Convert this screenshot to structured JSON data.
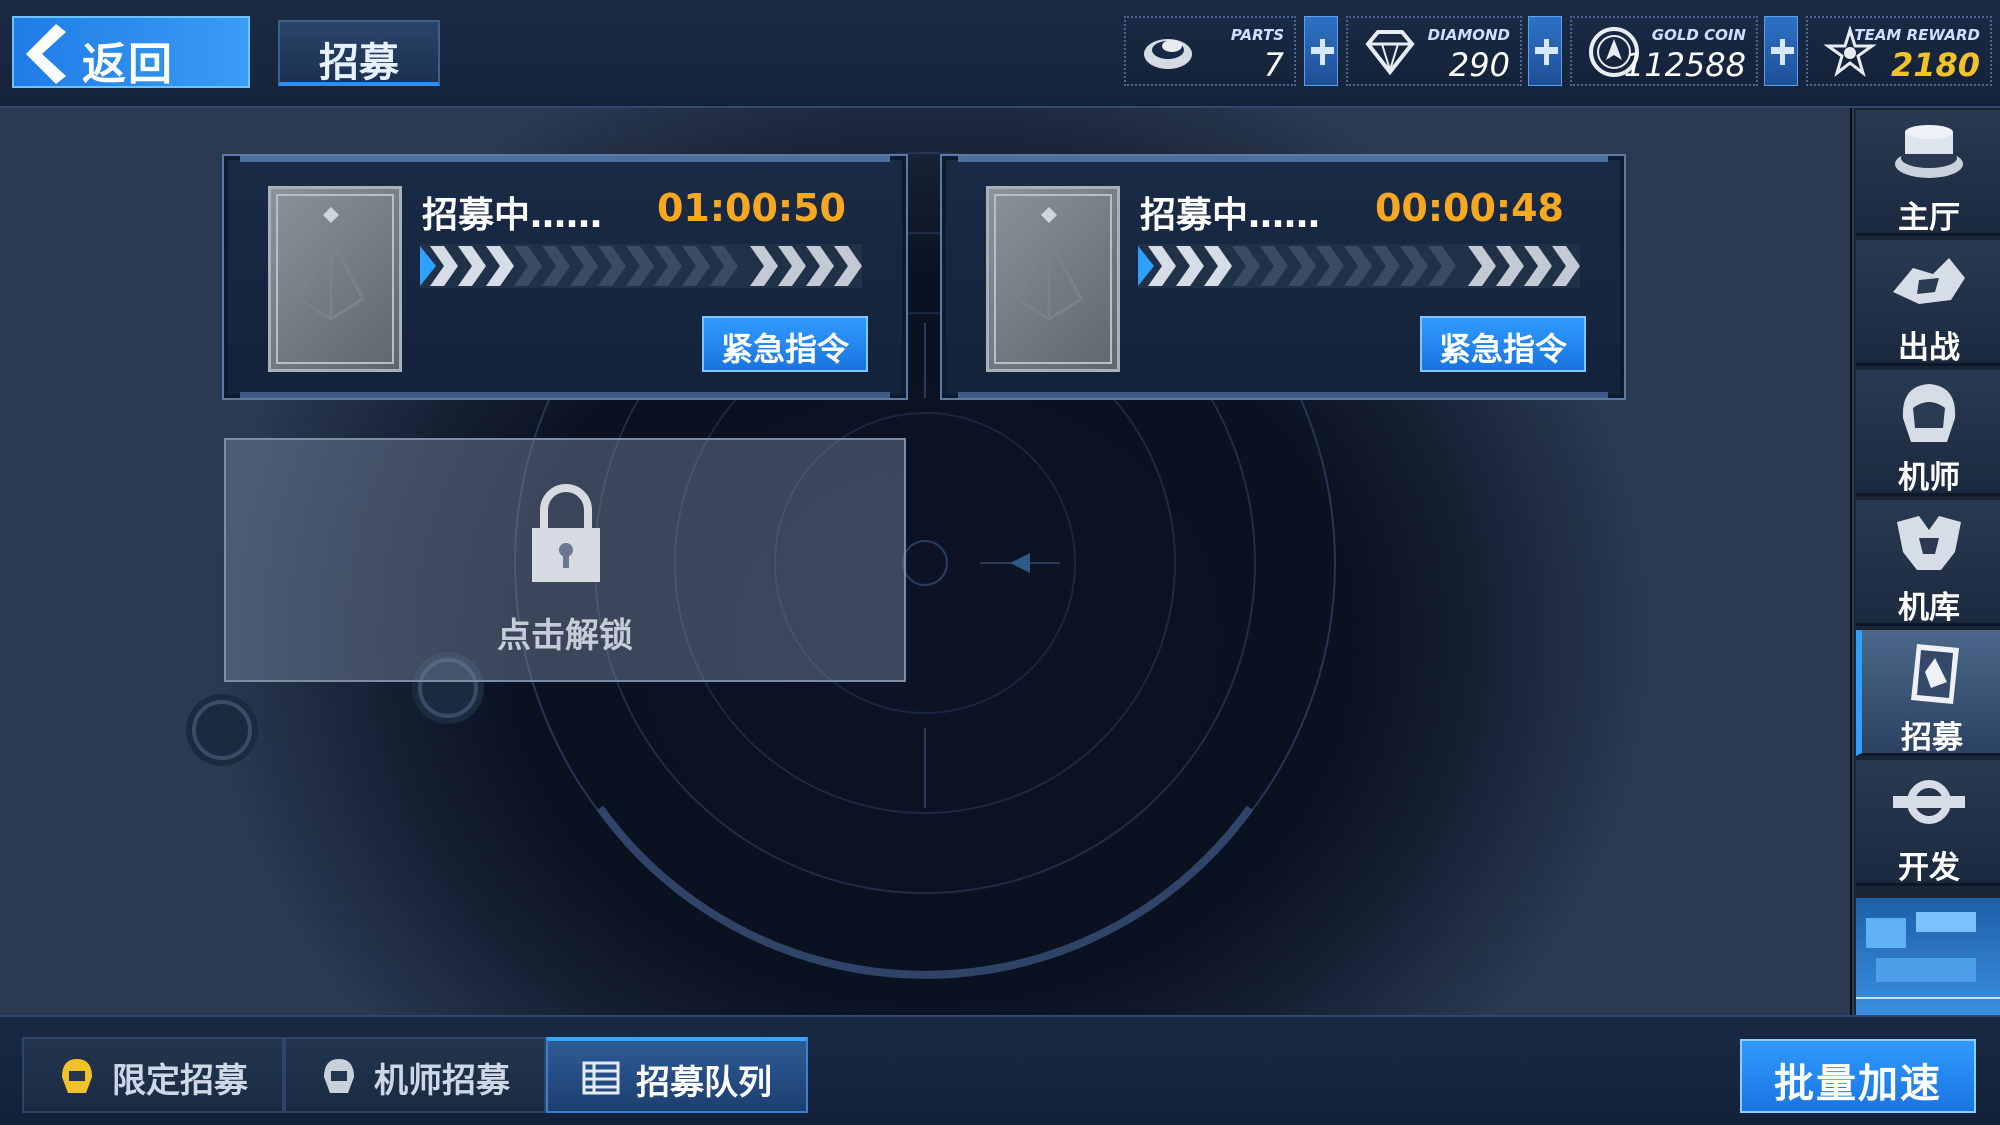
{
  "header": {
    "back_label": "返回",
    "title": "招募"
  },
  "resources": [
    {
      "name": "PARTS",
      "value": "7",
      "icon": "parts-icon"
    },
    {
      "name": "DIAMOND",
      "value": "290",
      "icon": "diamond-icon"
    },
    {
      "name": "GOLD COIN",
      "value": "112588",
      "icon": "gold-coin-icon"
    },
    {
      "name": "TEAM REWARD",
      "value": "2180",
      "icon": "team-reward-icon"
    }
  ],
  "queue": [
    {
      "status": "招募中……",
      "timer": "01:00:50",
      "action": "紧急指令"
    },
    {
      "status": "招募中……",
      "timer": "00:00:48",
      "action": "紧急指令"
    }
  ],
  "locked_slot": {
    "label": "点击解锁"
  },
  "sidebar": {
    "items": [
      {
        "label": "主厅",
        "icon": "hall-icon"
      },
      {
        "label": "出战",
        "icon": "sortie-icon"
      },
      {
        "label": "机师",
        "icon": "pilot-icon"
      },
      {
        "label": "机库",
        "icon": "hangar-icon"
      },
      {
        "label": "招募",
        "icon": "recruit-icon",
        "active": true
      },
      {
        "label": "开发",
        "icon": "develop-icon"
      }
    ]
  },
  "bottom_tabs": [
    {
      "label": "限定招募",
      "icon": "limited-recruit-icon"
    },
    {
      "label": "机师招募",
      "icon": "pilot-recruit-icon"
    },
    {
      "label": "招募队列",
      "icon": "queue-list-icon",
      "active": true
    }
  ],
  "batch_button": {
    "label": "批量加速"
  },
  "colors": {
    "accent": "#2f9bff",
    "timer": "#f6a821",
    "gold": "#f2c329"
  }
}
